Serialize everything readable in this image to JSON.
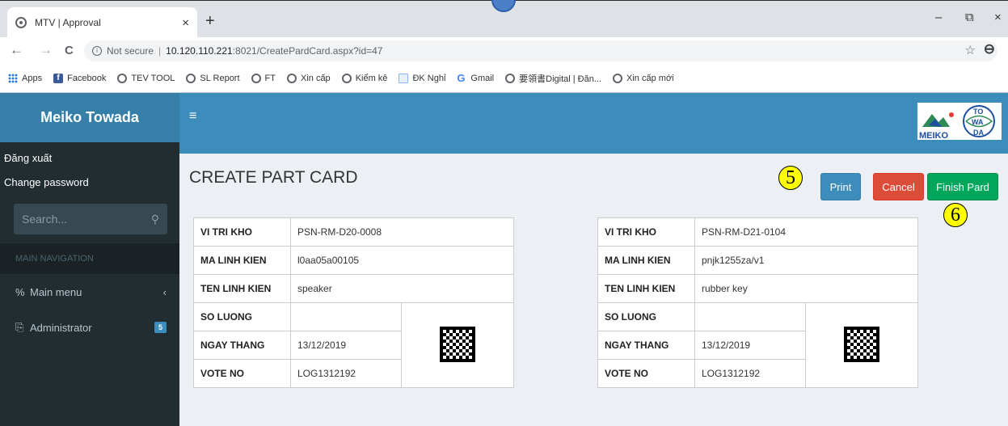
{
  "browser": {
    "tab_title": "MTV | Approval",
    "tab_close": "×",
    "new_tab": "+",
    "window_controls": {
      "minimize": "–",
      "restore": "⧉",
      "close": "×"
    },
    "nav": {
      "back": "←",
      "forward": "→",
      "reload": "C"
    },
    "security_label": "Not secure",
    "url_host": "10.120.110.221",
    "url_rest": ":8021/CreatePardCard.aspx?id=47",
    "bookmarks": [
      {
        "label": "Apps",
        "icon": "apps-icon"
      },
      {
        "label": "Facebook",
        "icon": "facebook-icon"
      },
      {
        "label": "TEV TOOL",
        "icon": "globe-icon"
      },
      {
        "label": "SL Report",
        "icon": "globe-icon"
      },
      {
        "label": "FT",
        "icon": "globe-icon"
      },
      {
        "label": "Xin cấp",
        "icon": "globe-icon"
      },
      {
        "label": "Kiểm kê",
        "icon": "globe-icon"
      },
      {
        "label": "ĐK Nghỉ",
        "icon": "document-icon"
      },
      {
        "label": "Gmail",
        "icon": "google-icon"
      },
      {
        "label": "要領書Digital | Đăn...",
        "icon": "globe-icon"
      },
      {
        "label": "Xin cấp mới",
        "icon": "globe-icon"
      }
    ]
  },
  "sidebar": {
    "brand": "Meiko Towada",
    "logout": "Đăng xuất",
    "change_password": "Change password",
    "search_placeholder": "Search...",
    "nav_header": "MAIN NAVIGATION",
    "items": [
      {
        "label": "Main menu",
        "icon": "link-icon"
      },
      {
        "label": "Administrator",
        "icon": "admin-icon",
        "badge": "5"
      }
    ]
  },
  "header": {
    "menu_toggle": "≡"
  },
  "page": {
    "title": "CREATE PART CARD",
    "markers": {
      "print": "5",
      "finish": "6"
    },
    "buttons": {
      "print": "Print",
      "cancel": "Cancel",
      "finish": "Finish Pard"
    }
  },
  "cards": [
    {
      "labels": [
        "VI TRI KHO",
        "MA LINH KIEN",
        "TEN LINH KIEN",
        "SO LUONG",
        "NGAY THANG",
        "VOTE NO"
      ],
      "values": [
        "PSN-RM-D20-0008",
        "l0aa05a00105",
        "speaker",
        "",
        "13/12/2019",
        "LOG1312192"
      ]
    },
    {
      "labels": [
        "VI TRI KHO",
        "MA LINH KIEN",
        "TEN LINH KIEN",
        "SO LUONG",
        "NGAY THANG",
        "VOTE NO"
      ],
      "values": [
        "PSN-RM-D21-0104",
        "pnjk1255za/v1",
        "rubber key",
        "",
        "13/12/2019",
        "LOG1312192"
      ]
    }
  ],
  "colors": {
    "sidebar": "#222d32",
    "header": "#3c8dbc",
    "brand": "#367fa9",
    "print": "#3c8dbc",
    "cancel": "#dd4b39",
    "finish": "#00a65a",
    "marker": "#ffff00"
  }
}
